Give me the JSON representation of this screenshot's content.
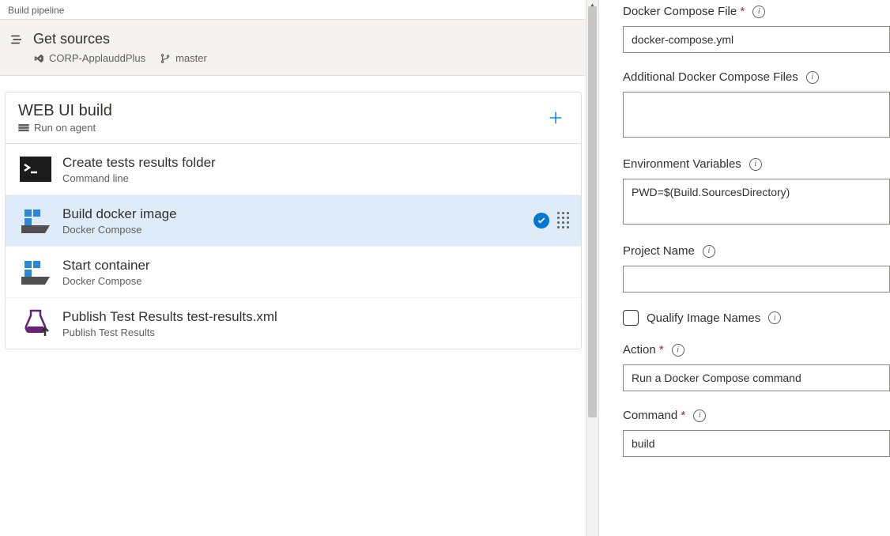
{
  "pipeline": {
    "title": "Build pipeline",
    "get_sources": {
      "title": "Get sources",
      "repo": "CORP-ApplauddPlus",
      "branch": "master"
    },
    "phase": {
      "title": "WEB UI build",
      "run_on": "Run on agent"
    },
    "tasks": [
      {
        "title": "Create tests results folder",
        "sub": "Command line"
      },
      {
        "title": "Build docker image",
        "sub": "Docker Compose"
      },
      {
        "title": "Start container",
        "sub": "Docker Compose"
      },
      {
        "title": "Publish Test Results test-results.xml",
        "sub": "Publish Test Results"
      }
    ]
  },
  "form": {
    "docker_compose_file": {
      "label": "Docker Compose File",
      "value": "docker-compose.yml"
    },
    "additional_files": {
      "label": "Additional Docker Compose Files",
      "value": ""
    },
    "env_vars": {
      "label": "Environment Variables",
      "value": "PWD=$(Build.SourcesDirectory)"
    },
    "project_name": {
      "label": "Project Name",
      "value": ""
    },
    "qualify": {
      "label": "Qualify Image Names"
    },
    "action": {
      "label": "Action",
      "value": "Run a Docker Compose command"
    },
    "command": {
      "label": "Command",
      "value": "build"
    }
  }
}
